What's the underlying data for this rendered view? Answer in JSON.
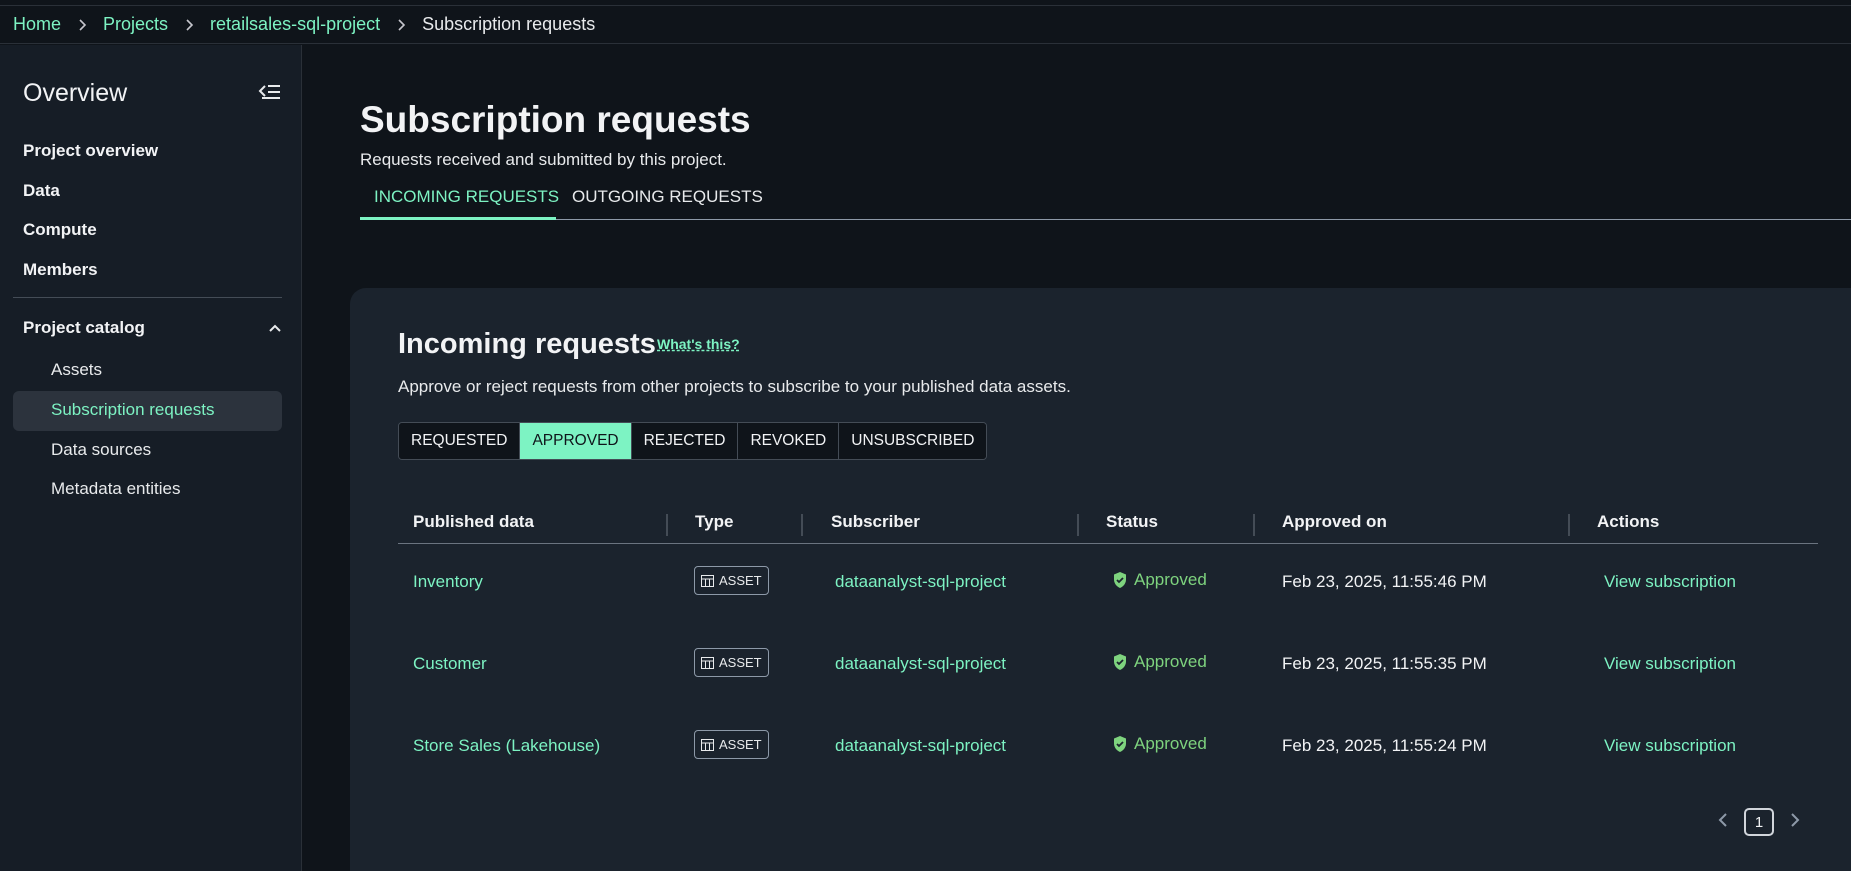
{
  "breadcrumb": {
    "home": "Home",
    "projects": "Projects",
    "project": "retailsales-sql-project",
    "current": "Subscription requests"
  },
  "sidebar": {
    "title": "Overview",
    "items": [
      {
        "label": "Project overview"
      },
      {
        "label": "Data"
      },
      {
        "label": "Compute"
      },
      {
        "label": "Members"
      }
    ],
    "group": {
      "label": "Project catalog",
      "items": [
        {
          "label": "Assets"
        },
        {
          "label": "Subscription requests"
        },
        {
          "label": "Data sources"
        },
        {
          "label": "Metadata entities"
        }
      ]
    }
  },
  "page": {
    "title": "Subscription requests",
    "description": "Requests received and submitted by this project.",
    "tabs": [
      {
        "label": "INCOMING REQUESTS"
      },
      {
        "label": "OUTGOING REQUESTS"
      }
    ]
  },
  "panel": {
    "title": "Incoming requests",
    "whats_this": "What's this?",
    "description": "Approve or reject requests from other projects to subscribe to your published data assets.",
    "filters": [
      {
        "label": "REQUESTED"
      },
      {
        "label": "APPROVED"
      },
      {
        "label": "REJECTED"
      },
      {
        "label": "REVOKED"
      },
      {
        "label": "UNSUBSCRIBED"
      }
    ],
    "columns": [
      "Published data",
      "Type",
      "Subscriber",
      "Status",
      "Approved on",
      "Actions"
    ],
    "rows": [
      {
        "published": "Inventory",
        "type": "ASSET",
        "subscriber": "dataanalyst-sql-project",
        "status": "Approved",
        "approved_on": "Feb 23, 2025, 11:55:46 PM",
        "action": "View subscription"
      },
      {
        "published": "Customer",
        "type": "ASSET",
        "subscriber": "dataanalyst-sql-project",
        "status": "Approved",
        "approved_on": "Feb 23, 2025, 11:55:35 PM",
        "action": "View subscription"
      },
      {
        "published": "Store Sales (Lakehouse)",
        "type": "ASSET",
        "subscriber": "dataanalyst-sql-project",
        "status": "Approved",
        "approved_on": "Feb 23, 2025, 11:55:24 PM",
        "action": "View subscription"
      }
    ],
    "pagination": {
      "page": "1"
    }
  },
  "colors": {
    "accent": "#7df3c3",
    "success": "#7ed37e",
    "background": "#0f141a"
  }
}
